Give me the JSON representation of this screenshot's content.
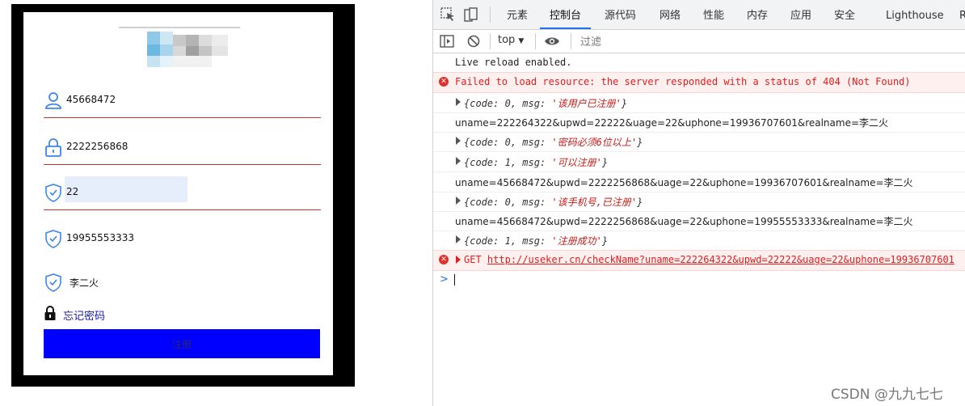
{
  "app_form": {
    "fields": [
      {
        "icon": "user-icon",
        "value": "45668472"
      },
      {
        "icon": "lock-icon",
        "value": "2222256868"
      },
      {
        "icon": "shield-icon",
        "value": "22"
      },
      {
        "icon": "shield-icon",
        "value": "19955553333"
      },
      {
        "icon": "shield-icon",
        "value": "李二火"
      }
    ],
    "forgot_password": "忘记密码",
    "register_button": "注册",
    "colors": {
      "underline": "#c0392b",
      "button": "#0000ff",
      "link": "#1a1aa6",
      "highlight": "#e6eefb"
    }
  },
  "devtools": {
    "tabs": [
      "元素",
      "控制台",
      "源代码",
      "网络",
      "性能",
      "内存",
      "应用",
      "安全",
      "Lighthouse",
      "R"
    ],
    "active_tab": "控制台",
    "context": "top",
    "filter_placeholder": "过滤",
    "console": [
      {
        "type": "log",
        "text": "Live reload enabled."
      },
      {
        "type": "error",
        "text": "Failed to load resource: the server responded with a status of 404 (Not Found)"
      },
      {
        "type": "object",
        "code": "0",
        "msg": "'该用户已注册'"
      },
      {
        "type": "log",
        "text": "uname=222264322&upwd=22222&uage=22&uphone=19936707601&realname=李二火"
      },
      {
        "type": "object",
        "code": "0",
        "msg": "'密码必须6位以上'"
      },
      {
        "type": "object",
        "code": "1",
        "msg": "'可以注册'"
      },
      {
        "type": "log",
        "text": "uname=45668472&upwd=2222256868&uage=22&uphone=19936707601&realname=李二火"
      },
      {
        "type": "object",
        "code": "0",
        "msg": "'该手机号,已注册'"
      },
      {
        "type": "log",
        "text": "uname=45668472&upwd=2222256868&uage=22&uphone=19955553333&realname=李二火"
      },
      {
        "type": "object",
        "code": "1",
        "msg": "'注册成功'"
      },
      {
        "type": "get",
        "method": "GET",
        "url": "http://useker.cn/checkName?uname=222264322&upwd=22222&uage=22&uphone=19936707601"
      }
    ],
    "prompt": ">",
    "colors": {
      "accent": "#1a73e8",
      "error": "#e11d1d",
      "error_bg": "#fff0f0"
    }
  },
  "watermark": "CSDN @九九七七"
}
